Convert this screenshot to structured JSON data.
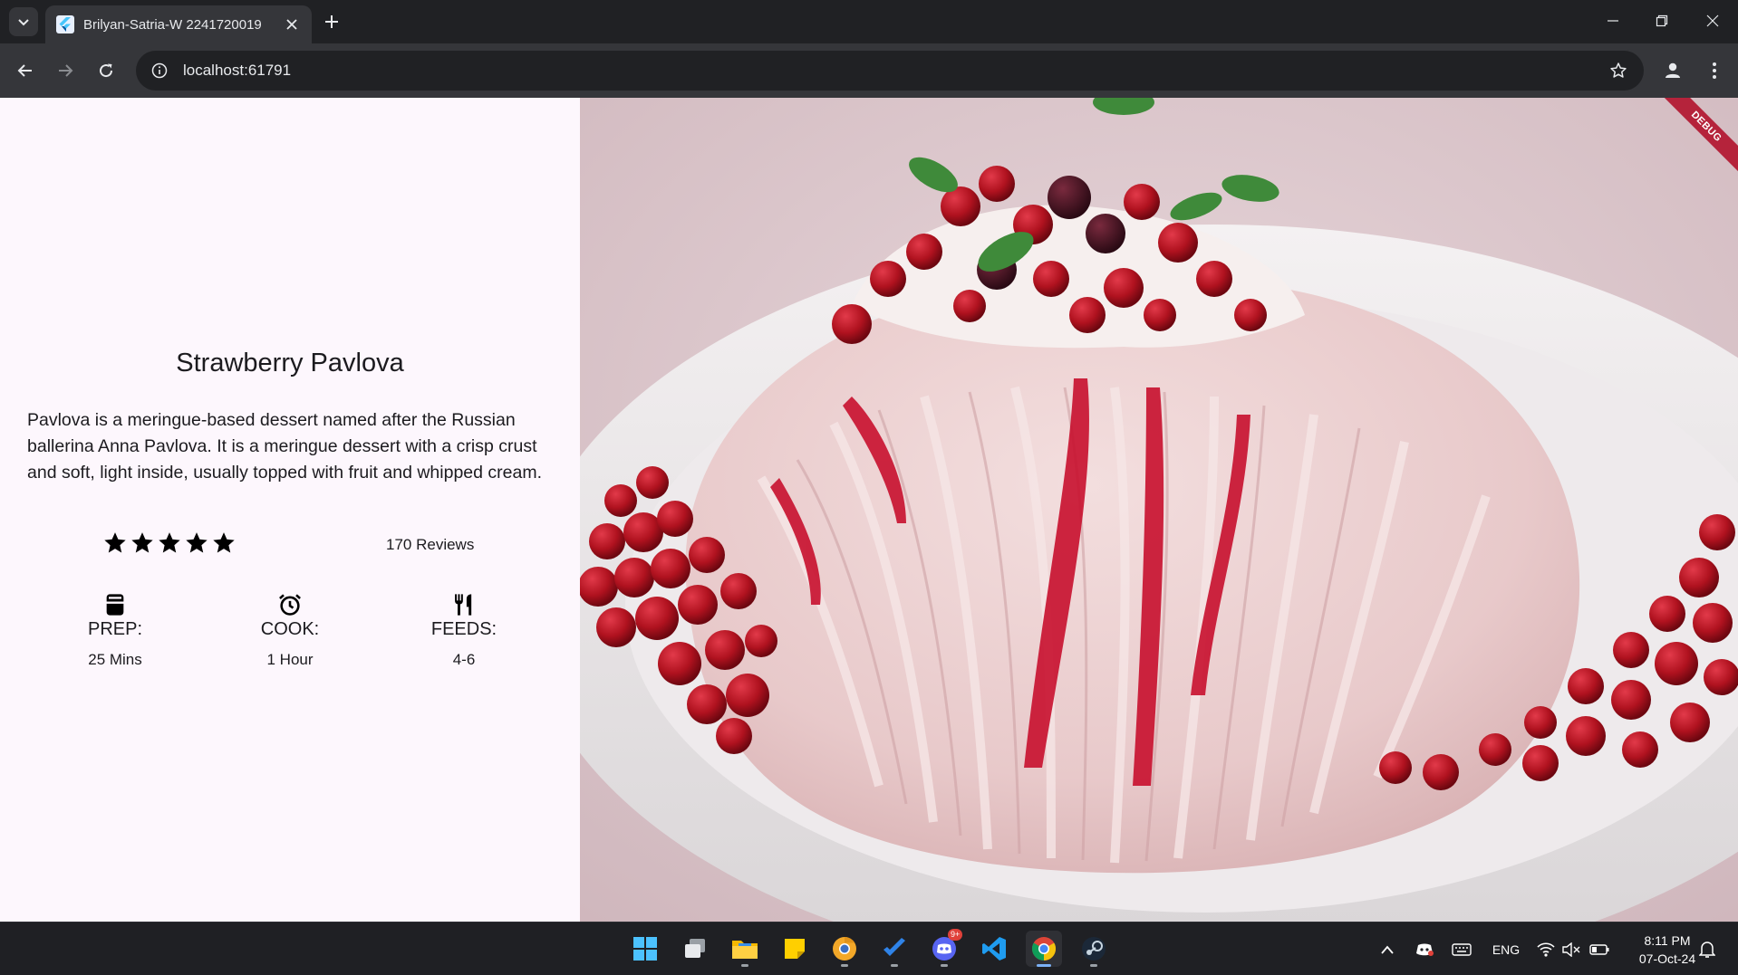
{
  "browser": {
    "tab_title": "Brilyan-Satria-W 2241720019",
    "url": "localhost:61791"
  },
  "recipe": {
    "title": "Strawberry Pavlova",
    "description": "Pavlova is a meringue-based dessert named after the Russian ballerina Anna Pavlova. It is a meringue dessert with a crisp crust and soft, light inside, usually topped with fruit and whipped cream.",
    "rating_stars": 5,
    "reviews": "170 Reviews",
    "info": [
      {
        "icon": "kitchen-icon",
        "label": "PREP:",
        "value": "25 Mins"
      },
      {
        "icon": "timer-icon",
        "label": "COOK:",
        "value": "1 Hour"
      },
      {
        "icon": "restaurant-icon",
        "label": "FEEDS:",
        "value": "4-6"
      }
    ],
    "image_alt": "strawberry pavlova photo"
  },
  "debug_banner": "DEBUG",
  "taskbar": {
    "apps": [
      "windows-start",
      "task-view",
      "file-explorer",
      "sticky-notes",
      "chrome-canary",
      "todo",
      "discord",
      "vscode",
      "chrome",
      "steam"
    ],
    "discord_badge": "9+",
    "language": "ENG",
    "time": "8:11 PM",
    "date": "07-Oct-24"
  },
  "colors": {
    "page_bg": "#fdf7fd",
    "chrome_dark": "#202124",
    "chrome_toolbar": "#35363a",
    "debug_red": "#b5233b"
  }
}
